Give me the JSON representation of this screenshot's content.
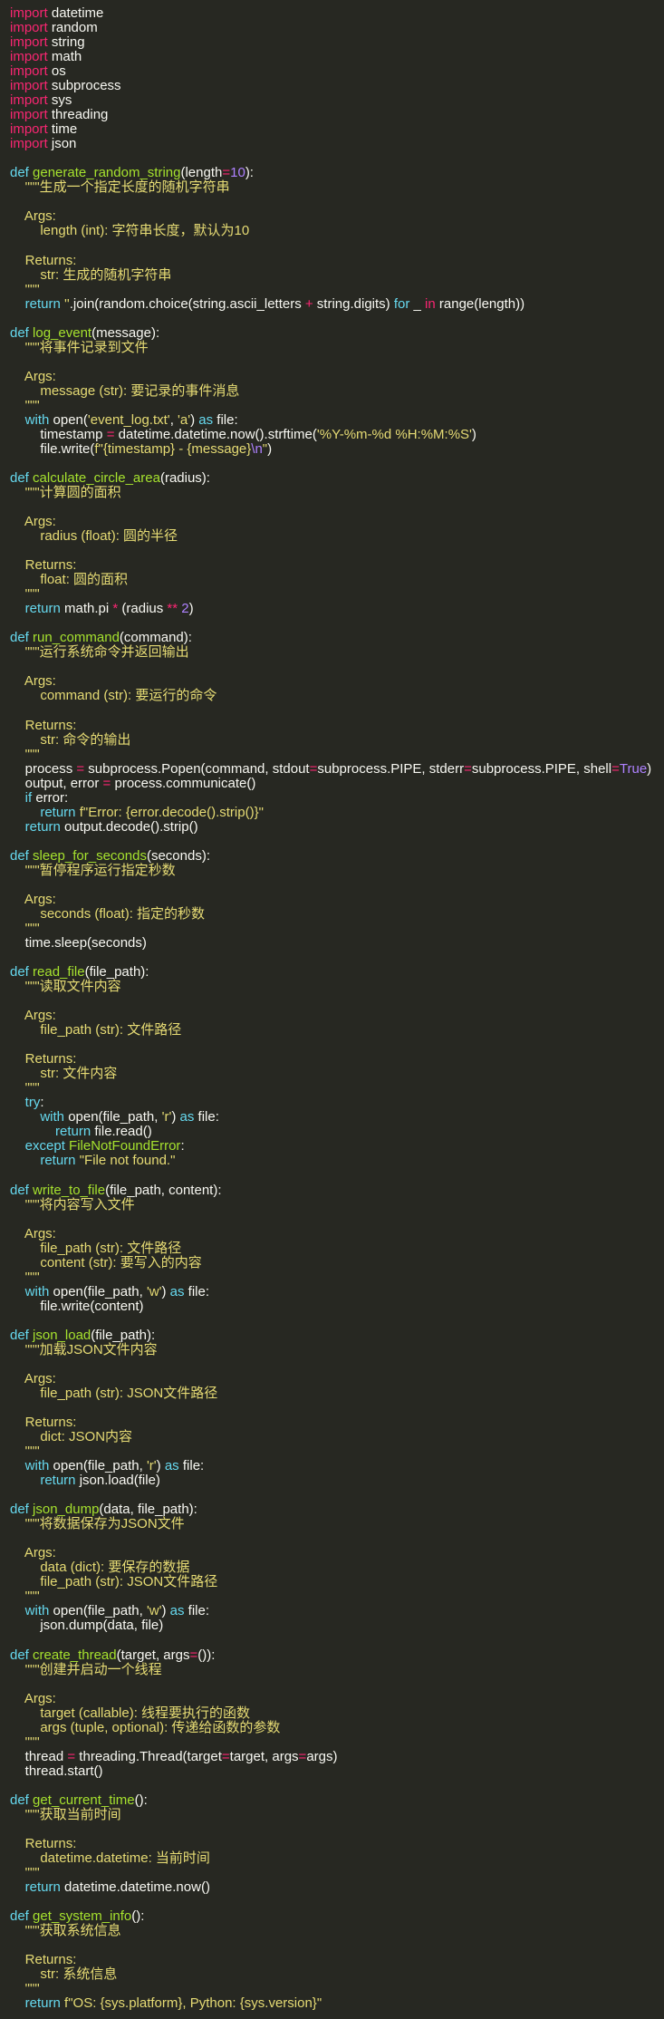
{
  "colors": {
    "background": "#272822",
    "text": "#f8f8f2",
    "keyword": "#f92672",
    "def_keyword": "#66d9ef",
    "function_name": "#a6e22e",
    "number": "#ae81ff",
    "string": "#e6db74",
    "builtin": "#66d9ef"
  },
  "code": {
    "lines": [
      [
        [
          "kw",
          "import"
        ],
        [
          "var",
          " datetime"
        ]
      ],
      [
        [
          "kw",
          "import"
        ],
        [
          "var",
          " random"
        ]
      ],
      [
        [
          "kw",
          "import"
        ],
        [
          "var",
          " string"
        ]
      ],
      [
        [
          "kw",
          "import"
        ],
        [
          "var",
          " math"
        ]
      ],
      [
        [
          "kw",
          "import"
        ],
        [
          "var",
          " os"
        ]
      ],
      [
        [
          "kw",
          "import"
        ],
        [
          "var",
          " subprocess"
        ]
      ],
      [
        [
          "kw",
          "import"
        ],
        [
          "var",
          " sys"
        ]
      ],
      [
        [
          "kw",
          "import"
        ],
        [
          "var",
          " threading"
        ]
      ],
      [
        [
          "kw",
          "import"
        ],
        [
          "var",
          " time"
        ]
      ],
      [
        [
          "kw",
          "import"
        ],
        [
          "var",
          " json"
        ]
      ],
      [],
      [
        [
          "def",
          "def "
        ],
        [
          "fn",
          "generate_random_string"
        ],
        [
          "var",
          "(length"
        ],
        [
          "op",
          "="
        ],
        [
          "num",
          "10"
        ],
        [
          "var",
          "):"
        ]
      ],
      [
        [
          "doc",
          "    \"\"\"生成一个指定长度的随机字符串"
        ]
      ],
      [],
      [
        [
          "doc",
          "    Args:"
        ]
      ],
      [
        [
          "doc",
          "        length (int): 字符串长度，默认为10"
        ]
      ],
      [],
      [
        [
          "doc",
          "    Returns:"
        ]
      ],
      [
        [
          "doc",
          "        str: 生成的随机字符串"
        ]
      ],
      [
        [
          "doc",
          "    \"\"\""
        ]
      ],
      [
        [
          "def",
          "    return "
        ],
        [
          "str",
          "''"
        ],
        [
          "var",
          ".join(random.choice(string.ascii_letters "
        ],
        [
          "op",
          "+"
        ],
        [
          "var",
          " string.digits) "
        ],
        [
          "def",
          "for"
        ],
        [
          "var",
          " _ "
        ],
        [
          "kw",
          "in"
        ],
        [
          "var",
          " range(length))"
        ]
      ],
      [],
      [
        [
          "def",
          "def "
        ],
        [
          "fn",
          "log_event"
        ],
        [
          "var",
          "(message):"
        ]
      ],
      [
        [
          "doc",
          "    \"\"\"将事件记录到文件"
        ]
      ],
      [],
      [
        [
          "doc",
          "    Args:"
        ]
      ],
      [
        [
          "doc",
          "        message (str): 要记录的事件消息"
        ]
      ],
      [
        [
          "doc",
          "    \"\"\""
        ]
      ],
      [
        [
          "def",
          "    with "
        ],
        [
          "var",
          "open("
        ],
        [
          "str",
          "'event_log.txt'"
        ],
        [
          "var",
          ", "
        ],
        [
          "str",
          "'a'"
        ],
        [
          "var",
          ") "
        ],
        [
          "def",
          "as"
        ],
        [
          "var",
          " file:"
        ]
      ],
      [
        [
          "var",
          "        timestamp "
        ],
        [
          "op",
          "="
        ],
        [
          "var",
          " datetime.datetime.now().strftime("
        ],
        [
          "str",
          "'%Y-%m-%d %H:%M:%S'"
        ],
        [
          "var",
          ")"
        ]
      ],
      [
        [
          "var",
          "        file.write("
        ],
        [
          "str",
          "f\"{timestamp} - {message}"
        ],
        [
          "num",
          "\\n"
        ],
        [
          "str",
          "\""
        ],
        [
          "var",
          ")"
        ]
      ],
      [],
      [
        [
          "def",
          "def "
        ],
        [
          "fn",
          "calculate_circle_area"
        ],
        [
          "var",
          "(radius):"
        ]
      ],
      [
        [
          "doc",
          "    \"\"\"计算圆的面积"
        ]
      ],
      [],
      [
        [
          "doc",
          "    Args:"
        ]
      ],
      [
        [
          "doc",
          "        radius (float): 圆的半径"
        ]
      ],
      [],
      [
        [
          "doc",
          "    Returns:"
        ]
      ],
      [
        [
          "doc",
          "        float: 圆的面积"
        ]
      ],
      [
        [
          "doc",
          "    \"\"\""
        ]
      ],
      [
        [
          "def",
          "    return "
        ],
        [
          "var",
          "math.pi "
        ],
        [
          "op",
          "*"
        ],
        [
          "var",
          " (radius "
        ],
        [
          "op",
          "**"
        ],
        [
          "var",
          " "
        ],
        [
          "num",
          "2"
        ],
        [
          "var",
          ")"
        ]
      ],
      [],
      [
        [
          "def",
          "def "
        ],
        [
          "fn",
          "run_command"
        ],
        [
          "var",
          "(command):"
        ]
      ],
      [
        [
          "doc",
          "    \"\"\"运行系统命令并返回输出"
        ]
      ],
      [],
      [
        [
          "doc",
          "    Args:"
        ]
      ],
      [
        [
          "doc",
          "        command (str): 要运行的命令"
        ]
      ],
      [],
      [
        [
          "doc",
          "    Returns:"
        ]
      ],
      [
        [
          "doc",
          "        str: 命令的输出"
        ]
      ],
      [
        [
          "doc",
          "    \"\"\""
        ]
      ],
      [
        [
          "var",
          "    process "
        ],
        [
          "op",
          "="
        ],
        [
          "var",
          " subprocess.Popen(command, stdout"
        ],
        [
          "op",
          "="
        ],
        [
          "var",
          "subprocess.PIPE, stderr"
        ],
        [
          "op",
          "="
        ],
        [
          "var",
          "subprocess.PIPE, shell"
        ],
        [
          "op",
          "="
        ],
        [
          "num",
          "True"
        ],
        [
          "var",
          ")"
        ]
      ],
      [
        [
          "var",
          "    output, error "
        ],
        [
          "op",
          "="
        ],
        [
          "var",
          " process.communicate()"
        ]
      ],
      [
        [
          "def",
          "    if "
        ],
        [
          "var",
          "error:"
        ]
      ],
      [
        [
          "def",
          "        return "
        ],
        [
          "str",
          "f\"Error: {error.decode().strip()}\""
        ]
      ],
      [
        [
          "def",
          "    return "
        ],
        [
          "var",
          "output.decode().strip()"
        ]
      ],
      [],
      [
        [
          "def",
          "def "
        ],
        [
          "fn",
          "sleep_for_seconds"
        ],
        [
          "var",
          "(seconds):"
        ]
      ],
      [
        [
          "doc",
          "    \"\"\"暂停程序运行指定秒数"
        ]
      ],
      [],
      [
        [
          "doc",
          "    Args:"
        ]
      ],
      [
        [
          "doc",
          "        seconds (float): 指定的秒数"
        ]
      ],
      [
        [
          "doc",
          "    \"\"\""
        ]
      ],
      [
        [
          "var",
          "    time.sleep(seconds)"
        ]
      ],
      [],
      [
        [
          "def",
          "def "
        ],
        [
          "fn",
          "read_file"
        ],
        [
          "var",
          "(file_path):"
        ]
      ],
      [
        [
          "doc",
          "    \"\"\"读取文件内容"
        ]
      ],
      [],
      [
        [
          "doc",
          "    Args:"
        ]
      ],
      [
        [
          "doc",
          "        file_path (str): 文件路径"
        ]
      ],
      [],
      [
        [
          "doc",
          "    Returns:"
        ]
      ],
      [
        [
          "doc",
          "        str: 文件内容"
        ]
      ],
      [
        [
          "doc",
          "    \"\"\""
        ]
      ],
      [
        [
          "def",
          "    try"
        ],
        [
          "var",
          ":"
        ]
      ],
      [
        [
          "def",
          "        with "
        ],
        [
          "var",
          "open(file_path, "
        ],
        [
          "str",
          "'r'"
        ],
        [
          "var",
          ") "
        ],
        [
          "def",
          "as"
        ],
        [
          "var",
          " file:"
        ]
      ],
      [
        [
          "def",
          "            return "
        ],
        [
          "var",
          "file.read()"
        ]
      ],
      [
        [
          "def",
          "    except "
        ],
        [
          "fn",
          "FileNotFoundError"
        ],
        [
          "var",
          ":"
        ]
      ],
      [
        [
          "def",
          "        return "
        ],
        [
          "str",
          "\"File not found.\""
        ]
      ],
      [],
      [
        [
          "def",
          "def "
        ],
        [
          "fn",
          "write_to_file"
        ],
        [
          "var",
          "(file_path, content):"
        ]
      ],
      [
        [
          "doc",
          "    \"\"\"将内容写入文件"
        ]
      ],
      [],
      [
        [
          "doc",
          "    Args:"
        ]
      ],
      [
        [
          "doc",
          "        file_path (str): 文件路径"
        ]
      ],
      [
        [
          "doc",
          "        content (str): 要写入的内容"
        ]
      ],
      [
        [
          "doc",
          "    \"\"\""
        ]
      ],
      [
        [
          "def",
          "    with "
        ],
        [
          "var",
          "open(file_path, "
        ],
        [
          "str",
          "'w'"
        ],
        [
          "var",
          ") "
        ],
        [
          "def",
          "as"
        ],
        [
          "var",
          " file:"
        ]
      ],
      [
        [
          "var",
          "        file.write(content)"
        ]
      ],
      [],
      [
        [
          "def",
          "def "
        ],
        [
          "fn",
          "json_load"
        ],
        [
          "var",
          "(file_path):"
        ]
      ],
      [
        [
          "doc",
          "    \"\"\"加载JSON文件内容"
        ]
      ],
      [],
      [
        [
          "doc",
          "    Args:"
        ]
      ],
      [
        [
          "doc",
          "        file_path (str): JSON文件路径"
        ]
      ],
      [],
      [
        [
          "doc",
          "    Returns:"
        ]
      ],
      [
        [
          "doc",
          "        dict: JSON内容"
        ]
      ],
      [
        [
          "doc",
          "    \"\"\""
        ]
      ],
      [
        [
          "def",
          "    with "
        ],
        [
          "var",
          "open(file_path, "
        ],
        [
          "str",
          "'r'"
        ],
        [
          "var",
          ") "
        ],
        [
          "def",
          "as"
        ],
        [
          "var",
          " file:"
        ]
      ],
      [
        [
          "def",
          "        return "
        ],
        [
          "var",
          "json.load(file)"
        ]
      ],
      [],
      [
        [
          "def",
          "def "
        ],
        [
          "fn",
          "json_dump"
        ],
        [
          "var",
          "(data, file_path):"
        ]
      ],
      [
        [
          "doc",
          "    \"\"\"将数据保存为JSON文件"
        ]
      ],
      [],
      [
        [
          "doc",
          "    Args:"
        ]
      ],
      [
        [
          "doc",
          "        data (dict): 要保存的数据"
        ]
      ],
      [
        [
          "doc",
          "        file_path (str): JSON文件路径"
        ]
      ],
      [
        [
          "doc",
          "    \"\"\""
        ]
      ],
      [
        [
          "def",
          "    with "
        ],
        [
          "var",
          "open(file_path, "
        ],
        [
          "str",
          "'w'"
        ],
        [
          "var",
          ") "
        ],
        [
          "def",
          "as"
        ],
        [
          "var",
          " file:"
        ]
      ],
      [
        [
          "var",
          "        json.dump(data, file)"
        ]
      ],
      [],
      [
        [
          "def",
          "def "
        ],
        [
          "fn",
          "create_thread"
        ],
        [
          "var",
          "(target, args"
        ],
        [
          "op",
          "="
        ],
        [
          "var",
          "()):"
        ]
      ],
      [
        [
          "doc",
          "    \"\"\"创建并启动一个线程"
        ]
      ],
      [],
      [
        [
          "doc",
          "    Args:"
        ]
      ],
      [
        [
          "doc",
          "        target (callable): 线程要执行的函数"
        ]
      ],
      [
        [
          "doc",
          "        args (tuple, optional): 传递给函数的参数"
        ]
      ],
      [
        [
          "doc",
          "    \"\"\""
        ]
      ],
      [
        [
          "var",
          "    thread "
        ],
        [
          "op",
          "="
        ],
        [
          "var",
          " threading.Thread(target"
        ],
        [
          "op",
          "="
        ],
        [
          "var",
          "target, args"
        ],
        [
          "op",
          "="
        ],
        [
          "var",
          "args)"
        ]
      ],
      [
        [
          "var",
          "    thread.start()"
        ]
      ],
      [],
      [
        [
          "def",
          "def "
        ],
        [
          "fn",
          "get_current_time"
        ],
        [
          "var",
          "():"
        ]
      ],
      [
        [
          "doc",
          "    \"\"\"获取当前时间"
        ]
      ],
      [],
      [
        [
          "doc",
          "    Returns:"
        ]
      ],
      [
        [
          "doc",
          "        datetime.datetime: 当前时间"
        ]
      ],
      [
        [
          "doc",
          "    \"\"\""
        ]
      ],
      [
        [
          "def",
          "    return "
        ],
        [
          "var",
          "datetime.datetime.now()"
        ]
      ],
      [],
      [
        [
          "def",
          "def "
        ],
        [
          "fn",
          "get_system_info"
        ],
        [
          "var",
          "():"
        ]
      ],
      [
        [
          "doc",
          "    \"\"\"获取系统信息"
        ]
      ],
      [],
      [
        [
          "doc",
          "    Returns:"
        ]
      ],
      [
        [
          "doc",
          "        str: 系统信息"
        ]
      ],
      [
        [
          "doc",
          "    \"\"\""
        ]
      ],
      [
        [
          "def",
          "    return "
        ],
        [
          "str",
          "f\"OS: {sys.platform}, Python: {sys.version}\""
        ]
      ]
    ]
  }
}
